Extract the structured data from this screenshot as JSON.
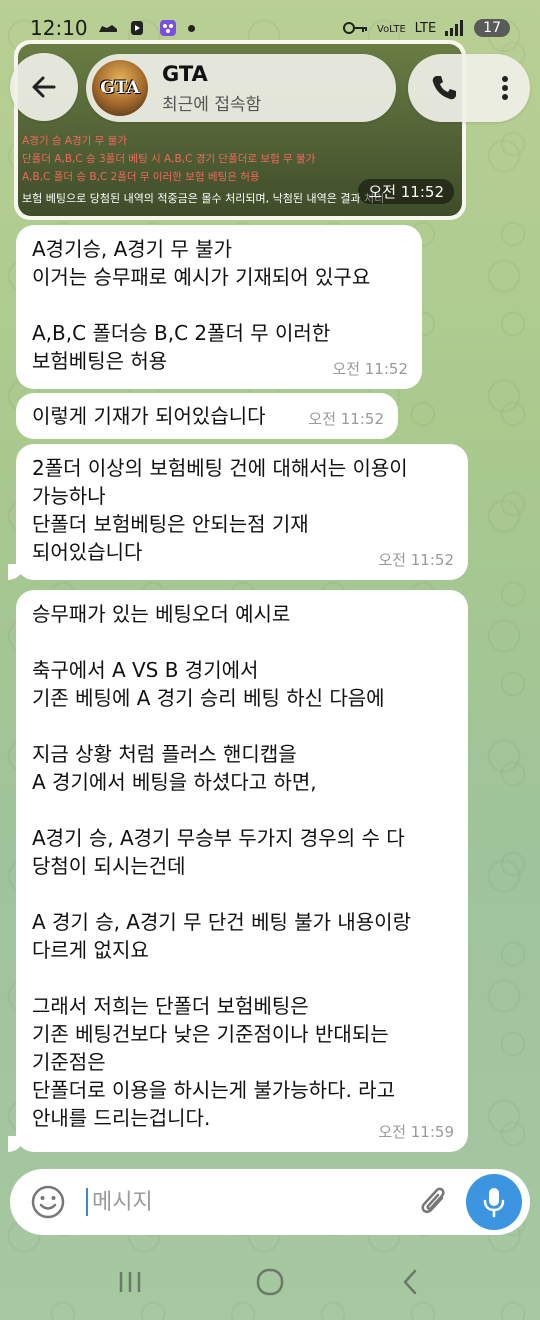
{
  "status_bar": {
    "time": "12:10",
    "net_label": "LTE",
    "battery": "17"
  },
  "header": {
    "title": "GTA",
    "subtitle": "최근에 접속함",
    "avatar_text": "GTA"
  },
  "photo_message": {
    "lines_red": [
      "A경기 승 A경기 무 불가",
      "단폴더 A,B,C 승 3폴더 베팅 시 A,B,C 경기 단폴더로 보험 무 불가",
      "A,B,C 폴더 승 B,C 2폴더 무 이러한 보험 베팅은 허용"
    ],
    "line_white": "보험 베팅으로 당첨된 내역의 적중금은 몰수 처리되며, 낙첨된 내역은 결과 처리",
    "time": "오전 11:52"
  },
  "messages": [
    {
      "text": "A경기승, A경기 무 불가\n이거는 승무패로 예시가 기재되어 있구요\n\nA,B,C 폴더승 B,C 2폴더 무 이러한\n보험베팅은 허용",
      "time": "오전 11:52"
    },
    {
      "text": "이렇게 기재가 되어있습니다",
      "time": "오전 11:52"
    },
    {
      "text": "2폴더 이상의 보험베팅 건에 대해서는 이용이\n가능하나\n단폴더 보험베팅은 안되는점 기재\n되어있습니다",
      "time": "오전 11:52"
    },
    {
      "text": "승무패가 있는 베팅오더 예시로\n\n축구에서 A VS B 경기에서\n기존 베팅에 A 경기 승리 베팅 하신 다음에\n\n지금 상황 처럼 플러스 핸디캡을\nA 경기에서 베팅을 하셨다고 하면,\n\nA경기 승, A경기 무승부 두가지 경우의 수 다\n당첨이 되시는건데\n\nA 경기 승, A경기 무 단건 베팅 불가 내용이랑\n다르게 없지요\n\n그래서 저희는 단폴더 보험베팅은\n기존 베팅건보다 낮은 기준점이나 반대되는\n기준점은\n단폴더로 이용을 하시는게 불가능하다. 라고\n안내를 드리는겁니다.",
      "time": "오전 11:59"
    }
  ],
  "composer": {
    "placeholder": "메시지"
  },
  "colors": {
    "bubble": "#ffffff",
    "accent": "#3b95e0",
    "photo_red_text": "#f06a5a"
  }
}
